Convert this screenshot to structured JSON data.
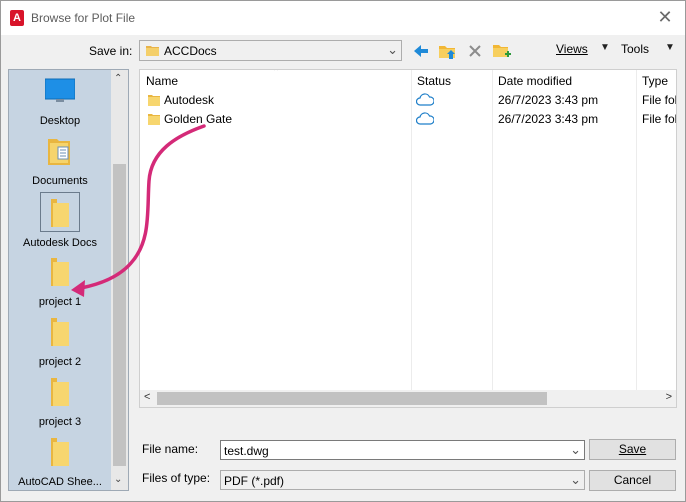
{
  "window": {
    "title": "Browse for Plot File",
    "close_glyph": "✕"
  },
  "toolbar": {
    "save_in_label": "Save in:",
    "save_in_value": "ACCDocs",
    "views_label": "Views",
    "tools_label": "Tools",
    "icons": [
      "back-arrow-icon",
      "up-folder-icon",
      "delete-icon",
      "new-folder-icon"
    ]
  },
  "places": [
    {
      "label": "Desktop",
      "icon": "desktop-icon"
    },
    {
      "label": "Documents",
      "icon": "documents-icon"
    },
    {
      "label": "Autodesk Docs",
      "icon": "folder-icon"
    },
    {
      "label": "project 1",
      "icon": "folder-icon"
    },
    {
      "label": "project 2",
      "icon": "folder-icon"
    },
    {
      "label": "project 3",
      "icon": "folder-icon"
    },
    {
      "label": "AutoCAD Shee...",
      "icon": "folder-icon"
    }
  ],
  "filelist": {
    "columns": [
      "Name",
      "Status",
      "Date modified",
      "Type"
    ],
    "rows": [
      {
        "name": "Autodesk",
        "status": "cloud-icon",
        "date": "26/7/2023 3:43 pm",
        "type": "File fol"
      },
      {
        "name": "Golden Gate",
        "status": "cloud-icon",
        "date": "26/7/2023 3:43 pm",
        "type": "File fol"
      }
    ]
  },
  "bottom": {
    "file_name_label": "File name:",
    "file_name_value": "test.dwg",
    "files_of_type_label": "Files of type:",
    "files_of_type_value": "PDF (*.pdf)",
    "save_label": "Save",
    "cancel_label": "Cancel"
  },
  "colors": {
    "places_bg": "#c6d4e2",
    "accent_blue": "#1f8ad8",
    "folder_yellow": "#f2c94c",
    "annotation_arrow": "#d42a78",
    "app_red": "#d8142a"
  }
}
